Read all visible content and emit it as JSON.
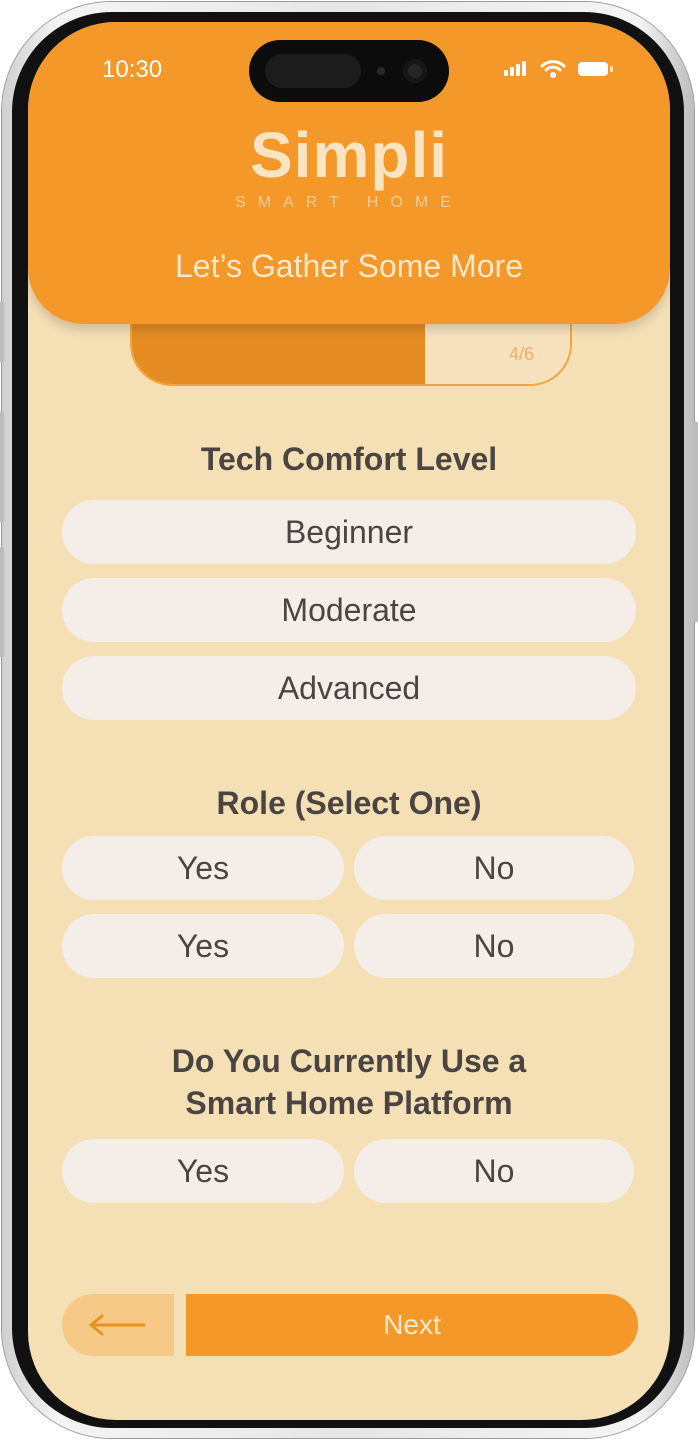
{
  "status_bar": {
    "time": "10:30",
    "icons": [
      "signal-icon",
      "wifi-icon",
      "battery-icon"
    ]
  },
  "brand": {
    "title": "Simpli",
    "subtitle": "SMART HOME"
  },
  "header": {
    "subtitle": "Let’s Gather Some More"
  },
  "progress": {
    "label": "4/6",
    "fraction": 0.67
  },
  "sections": {
    "tech": {
      "title": "Tech Comfort Level",
      "options": [
        "Beginner",
        "Moderate",
        "Advanced"
      ]
    },
    "role": {
      "title": "Role (Select One)",
      "options": [
        "Yes",
        "No",
        "Yes",
        "No"
      ]
    },
    "platform": {
      "title_line1": "Do You Currently Use a",
      "title_line2": "Smart Home Platform",
      "options": [
        "Yes",
        "No"
      ]
    }
  },
  "footer": {
    "back_icon": "arrow-left-icon",
    "next_label": "Next"
  },
  "colors": {
    "primary": "#f5982a",
    "background": "#f5dfb5",
    "option": "#f5eee8",
    "text": "#4a4542"
  }
}
